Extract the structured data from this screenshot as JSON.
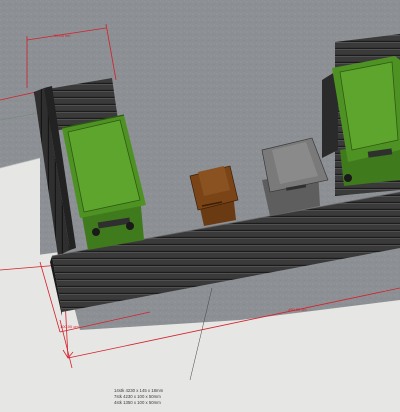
{
  "dimensions": {
    "top_width": "90.00 cm",
    "left_depth": "100.00 cm",
    "bottom_length": "450.00 cm"
  },
  "spec_lines": [
    "14stk  4230 x 145 x 18mm",
    "7stk   4230 x 100 x 50mm",
    "4stk   1350 x 100 x 50mm"
  ],
  "colors": {
    "ground": "#8c9094",
    "slab": "#e6e6e4",
    "fence": "#363636",
    "bin_green": "#4f9224",
    "bin_brown": "#7a4416",
    "bin_grey": "#6c6c6c",
    "dimension": "#d4202a"
  }
}
